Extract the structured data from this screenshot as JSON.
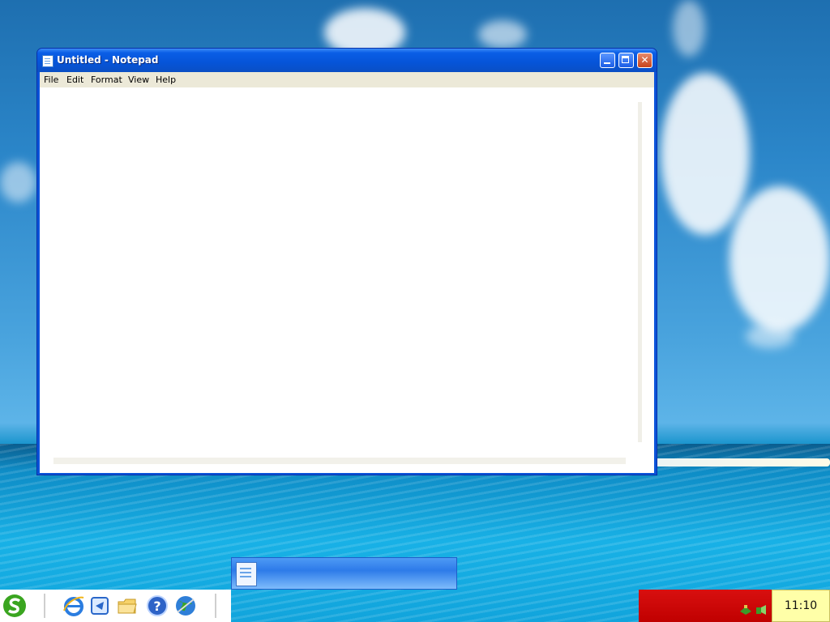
{
  "window": {
    "title": "Untitled - Notepad",
    "icon": "notepad-icon",
    "controls": [
      "minimize-icon",
      "maximize-icon",
      "close-icon"
    ],
    "close_glyph": "✕"
  },
  "menubar": {
    "file": "File",
    "edit": "Edit",
    "format": "Format",
    "view": "View",
    "help": "Help"
  },
  "editor": {
    "content": ""
  },
  "quicklaunch": {
    "icons": [
      "start-icon",
      "internet-explorer-icon",
      "documents-icon",
      "folder-icon",
      "help-icon",
      "globe-icon"
    ]
  },
  "taskbar": {
    "active_app_icon": "notepad-icon"
  },
  "tray": {
    "icons": [
      "network-icon",
      "volume-icon"
    ]
  },
  "clock": {
    "time": "11:10"
  },
  "colors": {
    "title_bar": "#0654d8",
    "close_button": "#c6431c",
    "tray_background": "#c00000",
    "clock_background": "#ffffa8",
    "menubar_background": "#ece9d8"
  }
}
